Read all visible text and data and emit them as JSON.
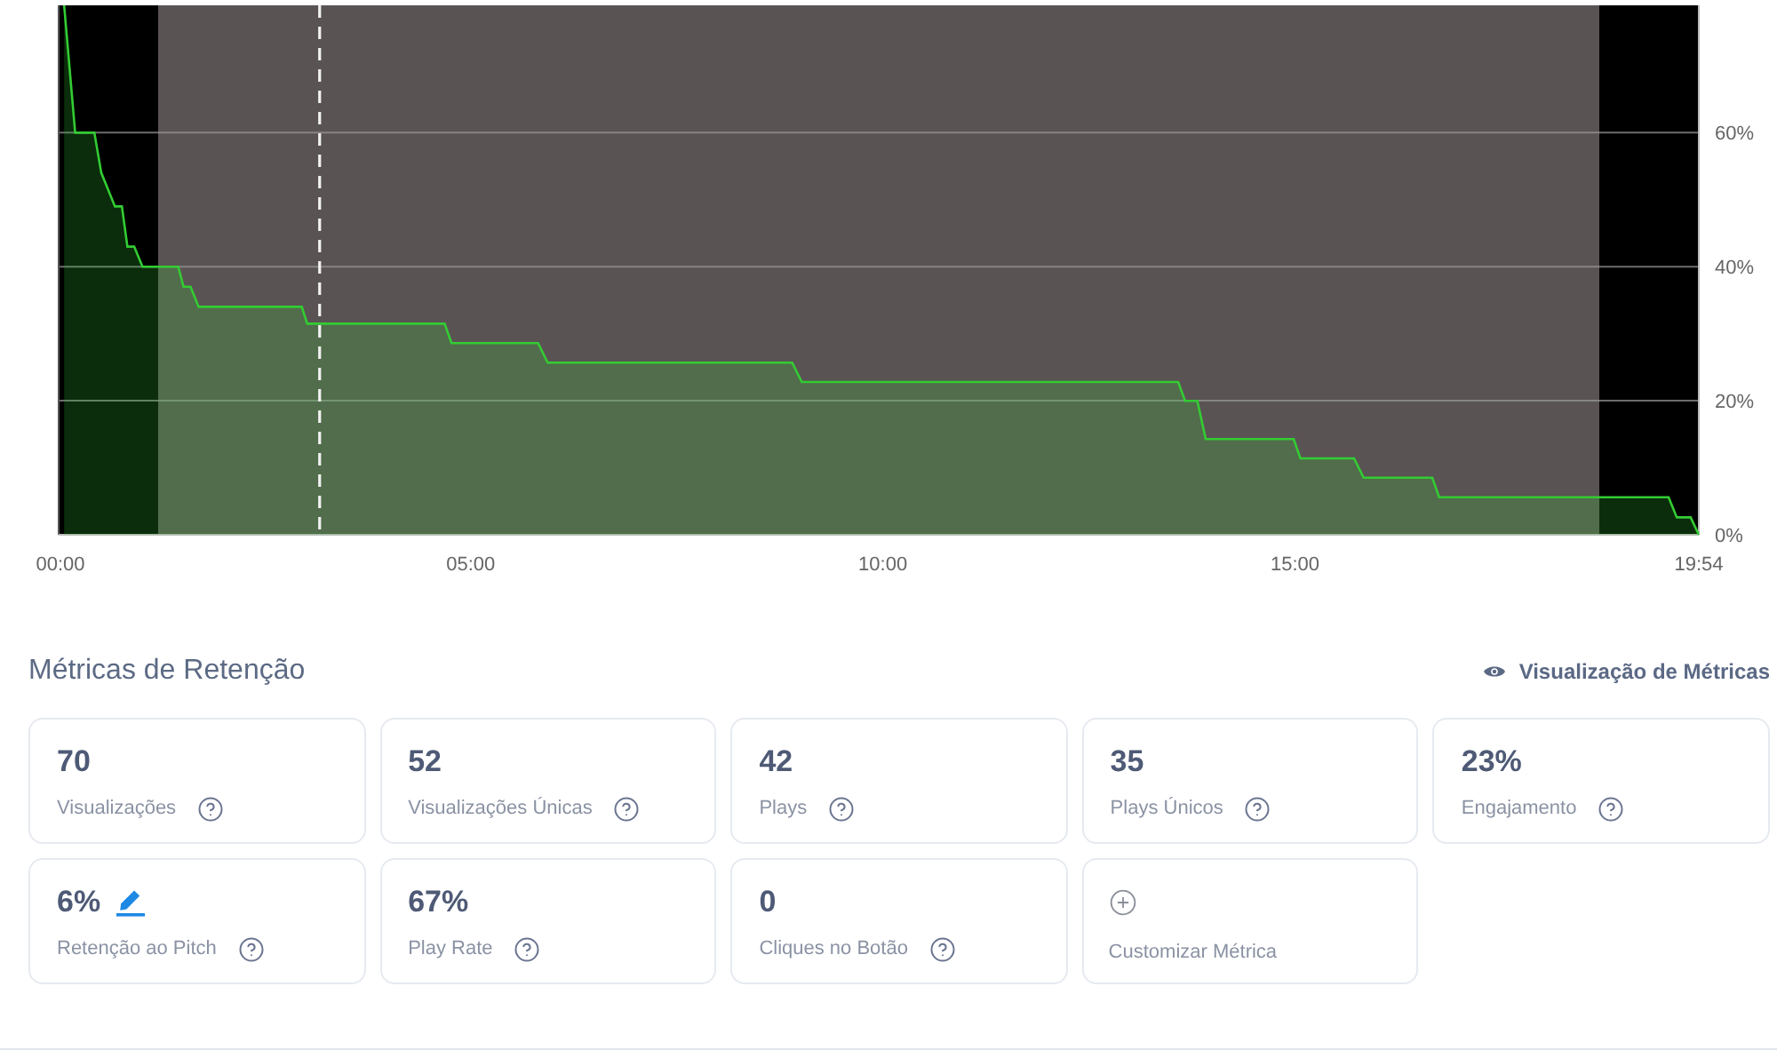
{
  "retention_chart": {
    "chart_data": {
      "type": "area",
      "x": [
        4,
        12,
        26,
        31,
        41,
        46,
        50,
        55,
        61,
        87,
        91,
        96,
        102,
        177,
        181,
        281,
        286,
        349,
        356,
        534,
        541,
        815,
        820,
        829,
        835,
        899,
        904,
        943,
        950,
        1000,
        1005,
        1172,
        1178,
        1188,
        1194
      ],
      "series": [
        {
          "color": "#33cc33",
          "values": [
            79,
            60,
            60,
            54,
            49,
            49,
            43,
            43,
            40,
            40,
            37,
            37,
            34,
            34,
            31.5,
            31.5,
            28.6,
            28.6,
            25.7,
            25.7,
            22.8,
            22.8,
            20,
            20,
            14.3,
            14.3,
            11.4,
            11.4,
            8.5,
            8.5,
            5.6,
            5.6,
            2.6,
            2.6,
            0
          ]
        }
      ],
      "xlim": [
        0,
        1194
      ],
      "ylim": [
        0,
        79
      ],
      "xticks": [
        {
          "value": 0,
          "label": "00:00"
        },
        {
          "value": 300,
          "label": "05:00"
        },
        {
          "value": 600,
          "label": "10:00"
        },
        {
          "value": 900,
          "label": "15:00"
        },
        {
          "value": 1194,
          "label": "19:54"
        }
      ],
      "yticks": [
        {
          "value": 0,
          "label": "0%"
        },
        {
          "value": 20,
          "label": "20%"
        },
        {
          "value": 40,
          "label": "40%"
        },
        {
          "value": 60,
          "label": "60%"
        }
      ],
      "grid": true,
      "ref_lines": [
        {
          "axis": "x",
          "value": 190
        }
      ]
    }
  },
  "metrics": {
    "title": "Métricas de Retenção",
    "view_link": "Visualização de Métricas",
    "cards": [
      {
        "kind": "metric",
        "value": "70",
        "label": "Visualizações",
        "editable": false
      },
      {
        "kind": "metric",
        "value": "52",
        "label": "Visualizações Únicas",
        "editable": false
      },
      {
        "kind": "metric",
        "value": "42",
        "label": "Plays",
        "editable": false
      },
      {
        "kind": "metric",
        "value": "35",
        "label": "Plays Únicos",
        "editable": false
      },
      {
        "kind": "metric",
        "value": "23%",
        "label": "Engajamento",
        "editable": false
      },
      {
        "kind": "metric",
        "value": "6%",
        "label": "Retenção ao Pitch",
        "editable": true
      },
      {
        "kind": "metric",
        "value": "67%",
        "label": "Play Rate",
        "editable": false
      },
      {
        "kind": "metric",
        "value": "0",
        "label": "Cliques no Botão",
        "editable": false
      },
      {
        "kind": "add",
        "label": "Customizar Métrica"
      }
    ]
  }
}
